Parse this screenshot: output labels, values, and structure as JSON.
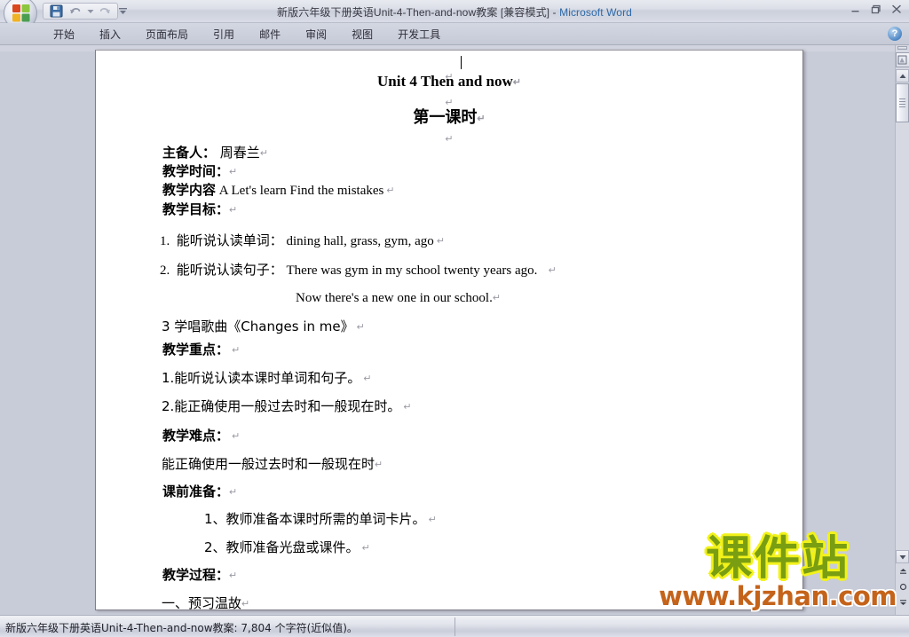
{
  "window": {
    "title_main": "新版六年级下册英语Unit-4-Then-and-now教案 [兼容模式]",
    "title_sep": " - ",
    "title_app": "Microsoft Word",
    "minimize_label": "—",
    "restore_label": "❐",
    "close_label": "✕",
    "help_label": "?"
  },
  "quick_access": {
    "office_button": "Office",
    "save_label": "save-icon",
    "undo_label": "↺",
    "undo_dropdown": "▾",
    "redo_label": "↻",
    "customize_label": "▾"
  },
  "ribbon": {
    "tabs": [
      {
        "label": "开始"
      },
      {
        "label": "插入"
      },
      {
        "label": "页面布局"
      },
      {
        "label": "引用"
      },
      {
        "label": "邮件"
      },
      {
        "label": "审阅"
      },
      {
        "label": "视图"
      },
      {
        "label": "开发工具"
      }
    ]
  },
  "document": {
    "heading": "Unit 4 Then and now",
    "subheading": "第一课时",
    "pilcrow": "↵",
    "lines": {
      "author_label": "主备人：",
      "author_value": "周春兰",
      "time_label": "教学时间：",
      "content_label": "教学内容",
      "content_value": "A   Let's learn     Find the mistakes",
      "goal_label": "教学目标：",
      "goal_1_num": "1.",
      "goal_1_cn": "能听说认读单词：",
      "goal_1_en": "dining hall, grass, gym, ago",
      "goal_2_num": "2.",
      "goal_2_cn": "能听说认读句子：",
      "goal_2_en": "There was gym in my school twenty years ago.",
      "goal_2_en_cont": "Now there's a new one in our school.",
      "goal_3": "3 学唱歌曲《Changes in me》",
      "focus_label": "教学重点：",
      "focus_1": "1.能听说认读本课时单词和句子。",
      "focus_2": "2.能正确使用一般过去时和一般现在时。",
      "difficulty_label": "教学难点：",
      "difficulty_1": "能正确使用一般过去时和一般现在时",
      "prep_label": "课前准备：",
      "prep_1": "1、教师准备本课时所需的单词卡片。",
      "prep_2": "2、教师准备光盘或课件。",
      "process_label": "教学过程：",
      "process_1": "一、预习温故"
    }
  },
  "watermark": {
    "brand": "课件站",
    "url": "www.kjzhan.com"
  },
  "statusbar": {
    "text": "新版六年级下册英语Unit-4-Then-and-now教案: 7,804 个字符(近似值)。"
  },
  "scrollbar": {
    "up_arrow": "▲",
    "down_arrow": "▼",
    "prev_page": "▲",
    "browse_object": "○",
    "next_page": "▼",
    "select_object_icon": "select-browse-object-icon"
  }
}
